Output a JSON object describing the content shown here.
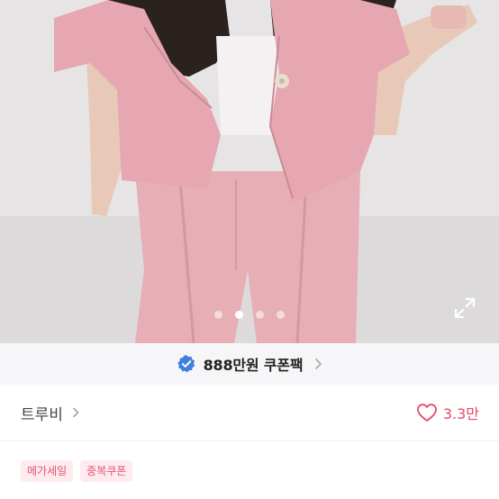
{
  "gallery": {
    "image_alt": "product photo",
    "slide_count": 4,
    "active_index": 1,
    "expand_icon": "expand-icon"
  },
  "coupon": {
    "badge_icon": "verified-badge-icon",
    "text": "888만원 쿠폰팩",
    "chevron_icon": "chevron-right-icon"
  },
  "store": {
    "name": "트루비",
    "chevron_icon": "chevron-right-icon"
  },
  "like": {
    "icon": "heart-outline-icon",
    "count": "3.3만",
    "color": "#e54a6a"
  },
  "tags": [
    {
      "label": "메가세일"
    },
    {
      "label": "중복쿠폰"
    }
  ],
  "product": {
    "title": ""
  }
}
